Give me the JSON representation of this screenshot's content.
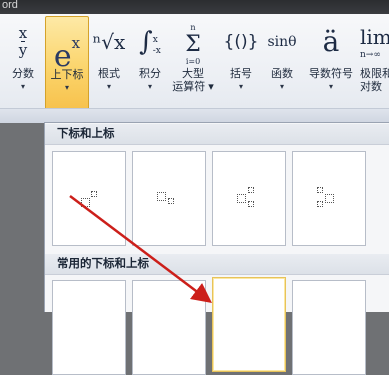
{
  "window": {
    "title": "ord"
  },
  "ribbon": {
    "buttons": [
      {
        "label": "分数",
        "icon": "fraction-icon",
        "symbol_top": "x",
        "symbol_bottom": "y"
      },
      {
        "label": "上下标",
        "icon": "script-icon",
        "symbol": "e",
        "sup": "x"
      },
      {
        "label": "根式",
        "icon": "radical-icon",
        "symbol": "ⁿ√x"
      },
      {
        "label": "积分",
        "icon": "integral-icon",
        "symbol": "∫",
        "sup": "x",
        "sub": "-x"
      },
      {
        "label": "大型",
        "label2": "运算符",
        "icon": "large-operator-icon",
        "symbol": "Σ",
        "sup": "n",
        "sub": "i=0"
      },
      {
        "label": "括号",
        "icon": "bracket-icon",
        "symbol": "{()}"
      },
      {
        "label": "函数",
        "icon": "function-icon",
        "symbol": "sinθ"
      },
      {
        "label": "导数符号",
        "icon": "accent-icon",
        "symbol": "ä"
      },
      {
        "label": "极限和",
        "label2": "对数",
        "icon": "limit-icon",
        "symbol": "lim",
        "sub": "n→∞"
      }
    ],
    "active_index": 1
  },
  "gallery": {
    "section1_title": "下标和上标",
    "section2_title": "常用的下标和上标"
  },
  "colors": {
    "accent": "#f6c04a",
    "arrow": "#cc1f1a"
  }
}
